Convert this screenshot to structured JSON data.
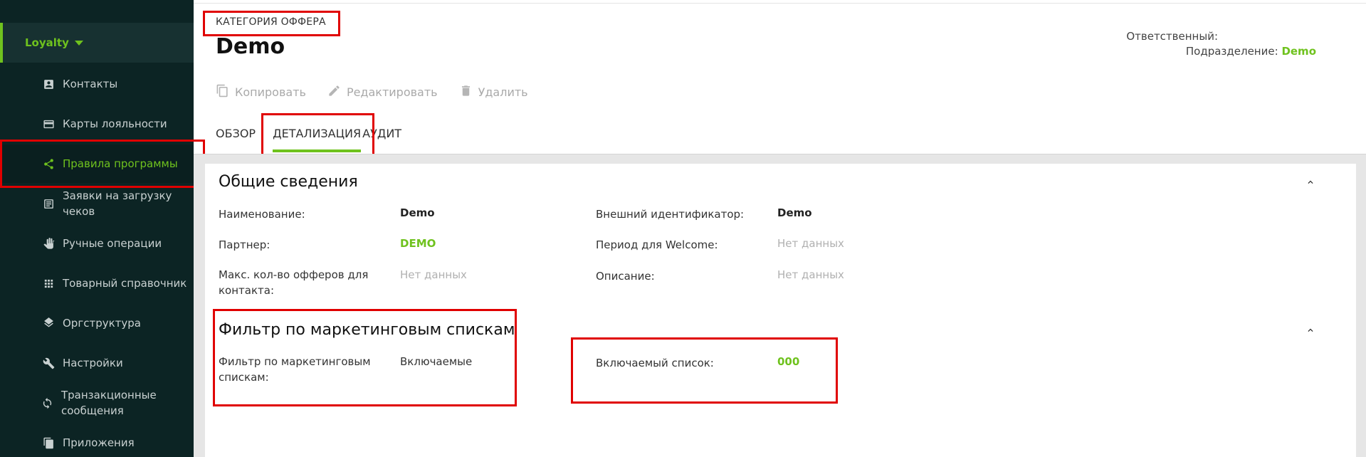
{
  "sidebar": {
    "module": {
      "label": "Loyalty"
    },
    "items": [
      {
        "label": "Контакты",
        "icon": "contact-card-icon"
      },
      {
        "label": "Карты лояльности",
        "icon": "credit-card-icon"
      },
      {
        "label": "Правила программы",
        "icon": "share-nodes-icon",
        "active": true
      },
      {
        "label": "Заявки на загрузку чеков",
        "icon": "receipt-list-icon"
      },
      {
        "label": "Ручные операции",
        "icon": "hand-icon"
      },
      {
        "label": "Товарный справочник",
        "icon": "grid-icon"
      },
      {
        "label": "Оргструктура",
        "icon": "layers-icon"
      },
      {
        "label": "Настройки",
        "icon": "wrench-icon"
      },
      {
        "label": "Транзакционные сообщения",
        "icon": "sync-icon"
      },
      {
        "label": "Приложения",
        "icon": "copy-pages-icon"
      }
    ]
  },
  "header": {
    "breadcrumb": "КАТЕГОРИЯ ОФФЕРА",
    "title": "Demo",
    "responsible_label": "Ответственный:",
    "division_label": "Подразделение:",
    "division_value": "Demo"
  },
  "toolbar": {
    "copy": "Копировать",
    "edit": "Редактировать",
    "delete": "Удалить"
  },
  "tabs": [
    {
      "label": "ОБЗОР"
    },
    {
      "label": "ДЕТАЛИЗАЦИЯ",
      "active": true
    },
    {
      "label": "АУДИТ"
    }
  ],
  "general": {
    "title": "Общие сведения",
    "name_label": "Наименование:",
    "name_value": "Demo",
    "ext_id_label": "Внешний идентификатор:",
    "ext_id_value": "Demo",
    "partner_label": "Партнер:",
    "partner_value": "DEMO",
    "welcome_label": "Период для Welcome:",
    "welcome_value": "Нет данных",
    "max_offers_label": "Макс. кол-во офферов для контакта:",
    "max_offers_value": "Нет данных",
    "description_label": "Описание:",
    "description_value": "Нет данных"
  },
  "filter": {
    "title": "Фильтр по маркетинговым спискам",
    "filter_label": "Фильтр по маркетинговым спискам:",
    "filter_value": "Включаемые",
    "included_label": "Включаемый список:",
    "included_value": "000"
  },
  "colors": {
    "accent": "#6fc21e",
    "sidebar_bg": "#0c2424",
    "highlight": "#e00000"
  }
}
